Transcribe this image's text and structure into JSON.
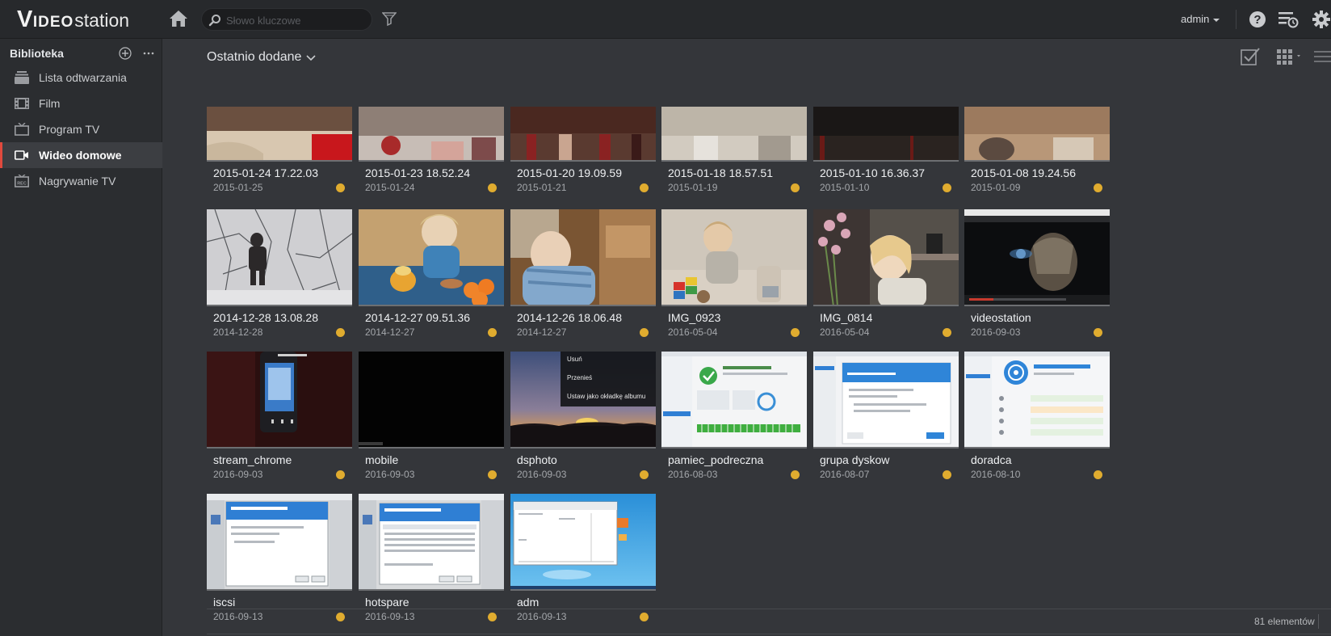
{
  "app": {
    "logo_v": "V",
    "logo_ideo": "IDEO",
    "logo_station": "station"
  },
  "search": {
    "placeholder": "Słowo kluczowe"
  },
  "user": {
    "name": "admin"
  },
  "sidebar": {
    "title": "Biblioteka",
    "items": [
      {
        "label": "Lista odtwarzania",
        "icon": "playlist-icon"
      },
      {
        "label": "Film",
        "icon": "film-icon"
      },
      {
        "label": "Program TV",
        "icon": "tv-icon"
      },
      {
        "label": "Wideo domowe",
        "icon": "home-video-icon",
        "active": true
      },
      {
        "label": "Nagrywanie TV",
        "icon": "tv-recording-icon"
      }
    ]
  },
  "main": {
    "title": "Ostatnio dodane",
    "tiles": [
      {
        "name": "2015-01-24 17.22.03",
        "date": "2015-01-25"
      },
      {
        "name": "2015-01-23 18.52.24",
        "date": "2015-01-24"
      },
      {
        "name": "2015-01-20 19.09.59",
        "date": "2015-01-21"
      },
      {
        "name": "2015-01-18 18.57.51",
        "date": "2015-01-19"
      },
      {
        "name": "2015-01-10 16.36.37",
        "date": "2015-01-10"
      },
      {
        "name": "2015-01-08 19.24.56",
        "date": "2015-01-09"
      },
      {
        "name": "2014-12-28 13.08.28",
        "date": "2014-12-28"
      },
      {
        "name": "2014-12-27 09.51.36",
        "date": "2014-12-27"
      },
      {
        "name": "2014-12-26 18.06.48",
        "date": "2014-12-27"
      },
      {
        "name": "IMG_0923",
        "date": "2016-05-04"
      },
      {
        "name": "IMG_0814",
        "date": "2016-05-04"
      },
      {
        "name": "videostation",
        "date": "2016-09-03"
      },
      {
        "name": "stream_chrome",
        "date": "2016-09-03"
      },
      {
        "name": "mobile",
        "date": "2016-09-03"
      },
      {
        "name": "dsphoto",
        "date": "2016-09-03"
      },
      {
        "name": "pamiec_podreczna",
        "date": "2016-08-03"
      },
      {
        "name": "grupa dyskow",
        "date": "2016-08-07"
      },
      {
        "name": "doradca",
        "date": "2016-08-10"
      },
      {
        "name": "iscsi",
        "date": "2016-09-13"
      },
      {
        "name": "hotspare",
        "date": "2016-09-13"
      },
      {
        "name": "adm",
        "date": "2016-09-13"
      }
    ],
    "dsphoto_menu": [
      "Usuń",
      "Przenieś",
      "Ustaw jako okładkę albumu"
    ],
    "footer_count": "81 elementów"
  },
  "colors": {
    "accent": "#e0493d",
    "status_dot": "#e0ac2f",
    "background": "#34363a",
    "topbar": "#27292c",
    "sidebar": "#2b2d30"
  }
}
